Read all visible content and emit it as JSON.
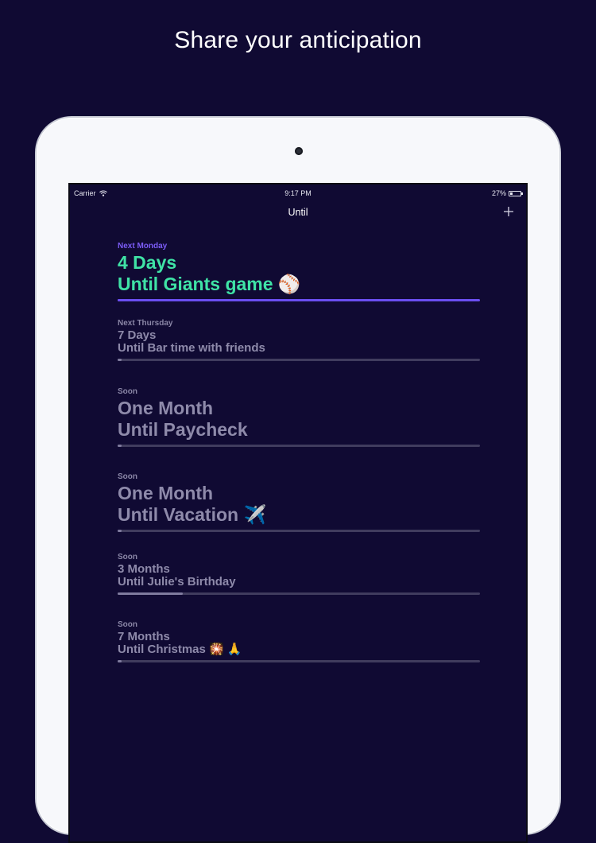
{
  "headline": "Share your anticipation",
  "status": {
    "carrier": "Carrier",
    "time": "9:17 PM",
    "battery": "27%",
    "battery_level": 0.27
  },
  "nav": {
    "title": "Until",
    "add_symbol": "+"
  },
  "countdowns": [
    {
      "when": "Next Monday",
      "count": "4 Days",
      "until": "Until Giants game ⚾",
      "progress": 0.01
    },
    {
      "when": "Next Thursday",
      "count": "7 Days",
      "until": "Until Bar time with friends",
      "progress": 0.01
    },
    {
      "when": "Soon",
      "count": "One Month",
      "until": "Until Paycheck",
      "progress": 0.01
    },
    {
      "when": "Soon",
      "count": "One Month",
      "until": "Until Vacation ✈️",
      "progress": 0.01
    },
    {
      "when": "Soon",
      "count": "3 Months",
      "until": "Until Julie's Birthday",
      "progress": 0.18
    },
    {
      "when": "Soon",
      "count": "7 Months",
      "until": "Until Christmas 🎇 🙏",
      "progress": 0.01
    }
  ],
  "colors": {
    "background": "#100a33",
    "accent_green": "#3fe3a6",
    "accent_purple": "#6a4ef0",
    "muted_text": "#8e8aaa"
  },
  "icons": {
    "wifi": "wifi-icon",
    "battery": "battery-icon",
    "add": "plus-icon"
  }
}
